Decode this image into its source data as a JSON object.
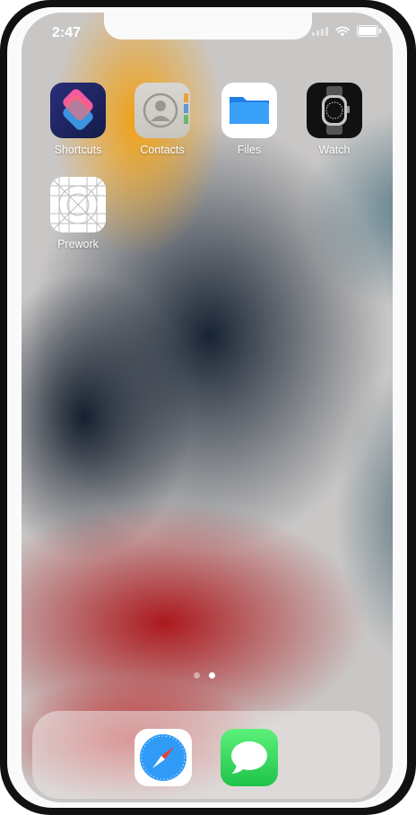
{
  "status_bar": {
    "time": "2:47"
  },
  "home": {
    "apps": [
      {
        "label": "Shortcuts",
        "icon": "shortcuts-icon"
      },
      {
        "label": "Contacts",
        "icon": "contacts-icon"
      },
      {
        "label": "Files",
        "icon": "files-icon"
      },
      {
        "label": "Watch",
        "icon": "watch-icon"
      },
      {
        "label": "Prework",
        "icon": "prework-icon"
      }
    ]
  },
  "page_indicator": {
    "pages": 2,
    "current": 2
  },
  "dock": {
    "apps": [
      {
        "icon": "safari-icon"
      },
      {
        "icon": "messages-icon"
      }
    ]
  }
}
